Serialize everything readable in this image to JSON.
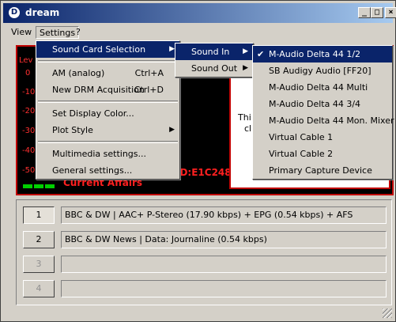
{
  "window": {
    "icon_letter": "D",
    "title": "dream",
    "minimize": "_",
    "maximize": "□",
    "close": "×"
  },
  "menubar": {
    "items": [
      {
        "label": "View"
      },
      {
        "label": "Settings"
      },
      {
        "label": "?"
      }
    ]
  },
  "display": {
    "level_label": "Lev",
    "scale": [
      "0",
      "-10",
      "-20",
      "-30",
      "-40",
      "-50"
    ],
    "cyan_glyph": "/",
    "service_label": "Current Affairs",
    "id_label": "ID:E1C248",
    "text_line1": "Thi",
    "text_line2": "cl"
  },
  "settings_menu": {
    "items": [
      {
        "label": "Sound Card Selection",
        "shortcut": "",
        "submenu": true
      },
      {
        "label": "AM (analog)",
        "shortcut": "Ctrl+A",
        "submenu": false
      },
      {
        "label": "New DRM Acquisition",
        "shortcut": "Ctrl+D",
        "submenu": false
      },
      {
        "label": "Set Display Color...",
        "shortcut": "",
        "submenu": false
      },
      {
        "label": "Plot Style",
        "shortcut": "",
        "submenu": true
      },
      {
        "label": "Multimedia settings...",
        "shortcut": "",
        "submenu": false
      },
      {
        "label": "General settings...",
        "shortcut": "",
        "submenu": false
      }
    ]
  },
  "soundcard_menu": {
    "items": [
      {
        "label": "Sound In"
      },
      {
        "label": "Sound Out"
      }
    ]
  },
  "sound_in_menu": {
    "items": [
      {
        "label": "M-Audio Delta 44 1/2",
        "checked": true
      },
      {
        "label": "SB Audigy Audio [FF20]",
        "checked": false
      },
      {
        "label": "M-Audio Delta 44 Multi",
        "checked": false
      },
      {
        "label": "M-Audio Delta 44 3/4",
        "checked": false
      },
      {
        "label": "M-Audio Delta 44 Mon. Mixer",
        "checked": false
      },
      {
        "label": "Virtual Cable 1",
        "checked": false
      },
      {
        "label": "Virtual Cable 2",
        "checked": false
      },
      {
        "label": "Primary Capture Device",
        "checked": false
      }
    ]
  },
  "stations": [
    {
      "number": "1",
      "info": "BBC & DW  |  AAC+ P-Stereo (17.90 kbps) + EPG (0.54 kbps) + AFS",
      "enabled": true
    },
    {
      "number": "2",
      "info": "BBC & DW News  |  Data: Journaline (0.54 kbps)",
      "enabled": true
    },
    {
      "number": "3",
      "info": "",
      "enabled": false
    },
    {
      "number": "4",
      "info": "",
      "enabled": false
    }
  ],
  "colors": {
    "titlebar_start": "#0a246a",
    "highlight": "#0a246a",
    "panel_border": "#c00000",
    "meter_green": "#00c000"
  }
}
